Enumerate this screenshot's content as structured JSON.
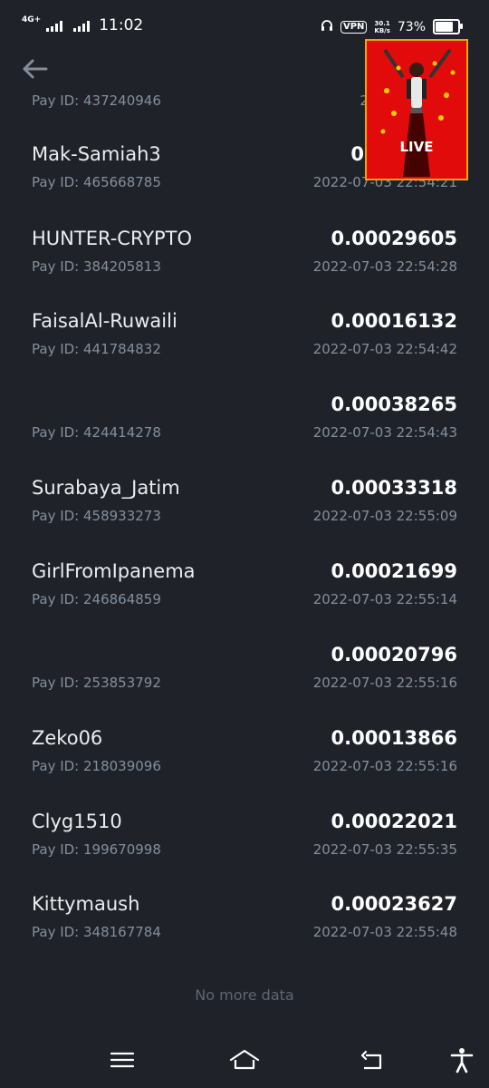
{
  "status_bar": {
    "network_type": "4G+",
    "time": "11:02",
    "vpn": "VPN",
    "speed_value": "30.1",
    "speed_unit": "KB/s",
    "battery_percent": "73%",
    "battery_level": 0.73,
    "icons": [
      "headphones-icon",
      "vpn-icon",
      "battery-icon",
      "signal-icon"
    ]
  },
  "header": {
    "back_icon": "arrow-left-icon"
  },
  "partial_row": {
    "pay_id": "Pay ID: 437240946",
    "time": "2022-07-0"
  },
  "rows": [
    {
      "name": "Mak-Samiah3",
      "amount": "0.",
      "pay_id": "Pay ID: 465668785",
      "time": "2022-07-03 22:54:21"
    },
    {
      "name": "HUNTER-CRYPTO",
      "amount": "0.00029605",
      "pay_id": "Pay ID: 384205813",
      "time": "2022-07-03 22:54:28"
    },
    {
      "name": "FaisalAl-Ruwaili",
      "amount": "0.00016132",
      "pay_id": "Pay ID: 441784832",
      "time": "2022-07-03 22:54:42"
    },
    {
      "name": "",
      "amount": "0.00038265",
      "pay_id": "Pay ID: 424414278",
      "time": "2022-07-03 22:54:43"
    },
    {
      "name": "Surabaya_Jatim",
      "amount": "0.00033318",
      "pay_id": "Pay ID: 458933273",
      "time": "2022-07-03 22:55:09"
    },
    {
      "name": "GirlFromIpanema",
      "amount": "0.00021699",
      "pay_id": "Pay ID: 246864859",
      "time": "2022-07-03 22:55:14"
    },
    {
      "name": "",
      "amount": "0.00020796",
      "pay_id": "Pay ID: 253853792",
      "time": "2022-07-03 22:55:16"
    },
    {
      "name": "Zeko06",
      "amount": "0.00013866",
      "pay_id": "Pay ID: 218039096",
      "time": "2022-07-03 22:55:16"
    },
    {
      "name": "Clyg1510",
      "amount": "0.00022021",
      "pay_id": "Pay ID: 199670998",
      "time": "2022-07-03 22:55:35"
    },
    {
      "name": "Kittymaush",
      "amount": "0.00023627",
      "pay_id": "Pay ID: 348167784",
      "time": "2022-07-03 22:55:48"
    }
  ],
  "footer": {
    "no_more_data": "No more data"
  },
  "live_overlay": {
    "label": "LIVE",
    "background_color": "#e20b0b",
    "border_color": "#f0a500"
  },
  "nav_bar": {
    "icons": [
      "menu-icon",
      "home-icon",
      "back-nav-icon",
      "accessibility-icon"
    ]
  },
  "colors": {
    "background": "#1f2329",
    "primary_text": "#eaecef",
    "secondary_text": "#848e9c",
    "muted_text": "#5e6673"
  }
}
